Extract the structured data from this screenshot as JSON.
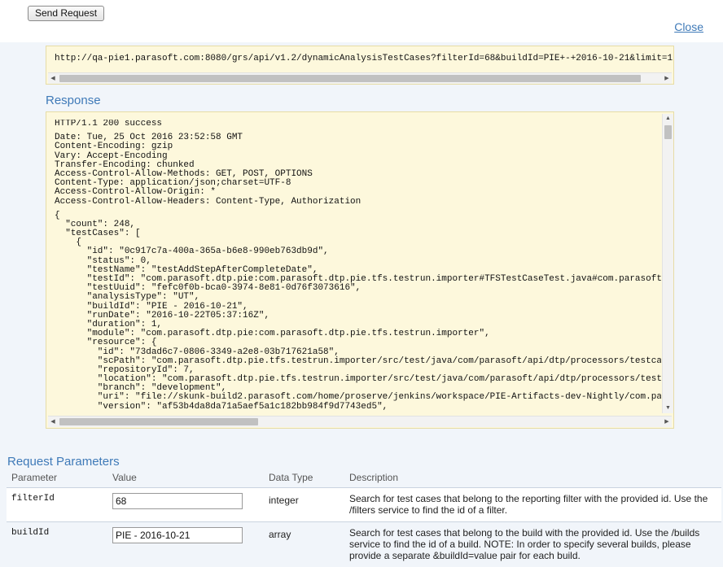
{
  "toolbar": {
    "send_label": "Send Request",
    "close_label": "Close"
  },
  "request_url": "http://qa-pie1.parasoft.com:8080/grs/api/v1.2/dynamicAnalysisTestCases?filterId=68&buildId=PIE+-+2016-10-21&limit=1(",
  "response": {
    "heading": "Response",
    "lines": [
      "HTTP/1.1 200 success",
      "",
      "Date: Tue, 25 Oct 2016 23:52:58 GMT",
      "Content-Encoding: gzip",
      "Vary: Accept-Encoding",
      "Transfer-Encoding: chunked",
      "Access-Control-Allow-Methods: GET, POST, OPTIONS",
      "Content-Type: application/json;charset=UTF-8",
      "Access-Control-Allow-Origin: *",
      "Access-Control-Allow-Headers: Content-Type, Authorization",
      "",
      "{",
      "  \"count\": 248,",
      "  \"testCases\": [",
      "    {",
      "      \"id\": \"0c917c7a-400a-365a-b6e8-990eb763db9d\",",
      "      \"status\": 0,",
      "      \"testName\": \"testAddStepAfterCompleteDate\",",
      "      \"testId\": \"com.parasoft.dtp.pie:com.parasoft.dtp.pie.tfs.testrun.importer#TFSTestCaseTest.java#com.parasoft",
      "      \"testUuid\": \"fefc0f0b-bca0-3974-8e81-0d76f3073616\",",
      "      \"analysisType\": \"UT\",",
      "      \"buildId\": \"PIE - 2016-10-21\",",
      "      \"runDate\": \"2016-10-22T05:37:16Z\",",
      "      \"duration\": 1,",
      "      \"module\": \"com.parasoft.dtp.pie:com.parasoft.dtp.pie.tfs.testrun.importer\",",
      "      \"resource\": {",
      "        \"id\": \"73dad6c7-0806-3349-a2e8-03b717621a58\",",
      "        \"scPath\": \"com.parasoft.dtp.pie.tfs.testrun.importer/src/test/java/com/parasoft/api/dtp/processors/testca",
      "        \"repositoryId\": 7,",
      "        \"location\": \"com.parasoft.dtp.pie.tfs.testrun.importer/src/test/java/com/parasoft/api/dtp/processors/test",
      "        \"branch\": \"development\",",
      "        \"uri\": \"file://skunk-build2.parasoft.com/home/proserve/jenkins/workspace/PIE-Artifacts-dev-Nightly/com.pa",
      "        \"version\": \"af53b4da8da71a5aef5a1c182bb984f9d7743ed5\","
    ]
  },
  "params": {
    "heading": "Request Parameters",
    "columns": {
      "parameter": "Parameter",
      "value": "Value",
      "type": "Data Type",
      "description": "Description"
    },
    "rows": [
      {
        "name": "filterId",
        "value": "68",
        "type": "integer",
        "description": "Search for test cases that belong to the reporting filter with the provided id. Use the /filters service to find the id of a filter."
      },
      {
        "name": "buildId",
        "value": "PIE - 2016-10-21",
        "type": "array",
        "description": "Search for test cases that belong to the build with the provided id. Use the /builds service to find the id of a build. NOTE: In order to specify several builds, please provide a separate &buildId=value pair for each build."
      }
    ]
  }
}
